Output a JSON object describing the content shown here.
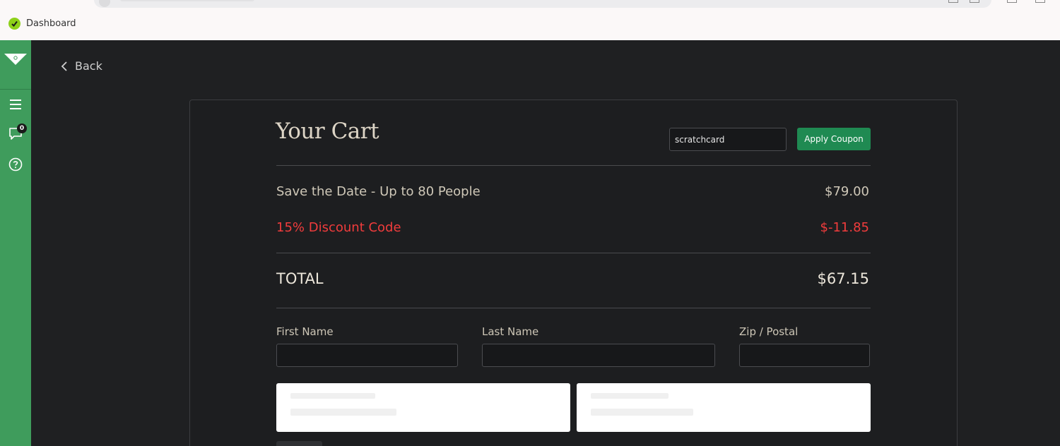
{
  "browser": {
    "bookmark_label": "Dashboard"
  },
  "sidebar": {
    "notification_count": "0"
  },
  "nav": {
    "back_label": "Back"
  },
  "cart": {
    "title": "Your Cart",
    "coupon_value": "scratchcard",
    "apply_label": "Apply Coupon",
    "items": [
      {
        "label": "Save the Date - Up to 80 People",
        "amount": "$79.00"
      },
      {
        "label": "15% Discount Code",
        "amount": "$-11.85"
      }
    ],
    "total_label": "TOTAL",
    "total_amount": "$67.15"
  },
  "form": {
    "first_name_label": "First Name",
    "last_name_label": "Last Name",
    "zip_label": "Zip / Postal"
  },
  "colors": {
    "sidebar": "#3f9c5c",
    "accent_button": "#1f8a52",
    "discount": "#f13c3c",
    "background": "#1f2022"
  }
}
